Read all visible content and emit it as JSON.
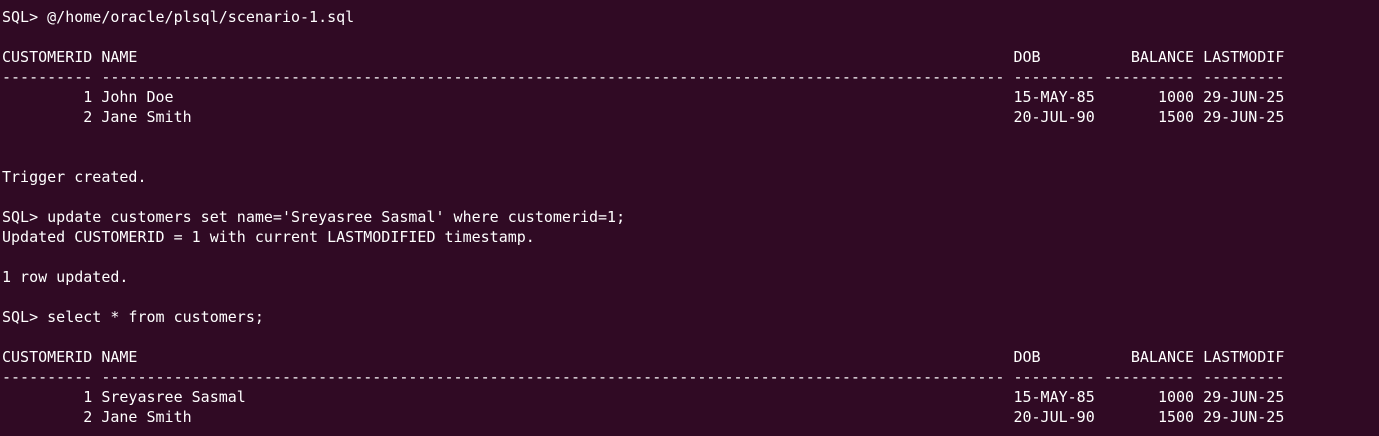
{
  "terminal": {
    "lines": [
      "SQL> @/home/oracle/plsql/scenario-1.sql",
      "",
      "CUSTOMERID NAME                                                                                                 DOB          BALANCE LASTMODIF",
      "---------- ---------------------------------------------------------------------------------------------------- --------- ---------- ---------",
      "         1 John Doe                                                                                             15-MAY-85       1000 29-JUN-25",
      "         2 Jane Smith                                                                                           20-JUL-90       1500 29-JUN-25",
      "",
      "",
      "Trigger created.",
      "",
      "SQL> update customers set name='Sreyasree Sasmal' where customerid=1;",
      "Updated CUSTOMERID = 1 with current LASTMODIFIED timestamp.",
      "",
      "1 row updated.",
      "",
      "SQL> select * from customers;",
      "",
      "CUSTOMERID NAME                                                                                                 DOB          BALANCE LASTMODIF",
      "---------- ---------------------------------------------------------------------------------------------------- --------- ---------- ---------",
      "         1 Sreyasree Sasmal                                                                                     15-MAY-85       1000 29-JUN-25",
      "         2 Jane Smith                                                                                           20-JUL-90       1500 29-JUN-25"
    ]
  }
}
